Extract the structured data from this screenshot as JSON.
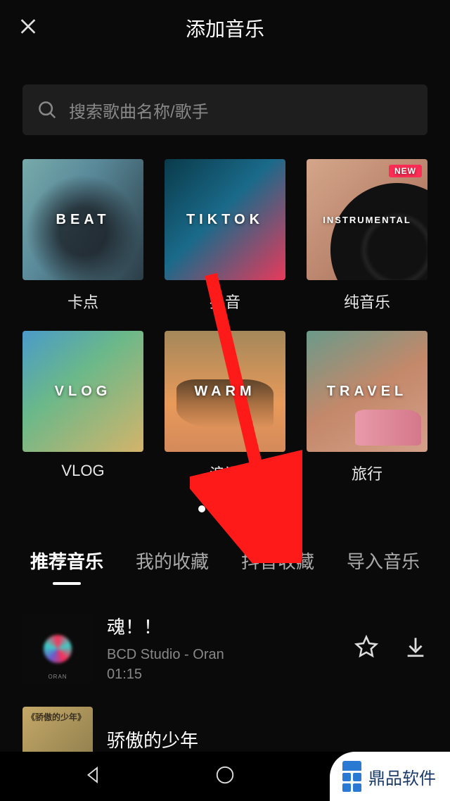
{
  "header": {
    "title": "添加音乐"
  },
  "search": {
    "placeholder": "搜索歌曲名称/歌手"
  },
  "categories": [
    {
      "overlay": "BEAT",
      "label": "卡点",
      "style": "cat-beat",
      "badge": null
    },
    {
      "overlay": "TIKTOK",
      "label": "抖音",
      "style": "cat-tiktok",
      "badge": null
    },
    {
      "overlay": "INSTRUMENTAL",
      "label": "纯音乐",
      "style": "cat-instrumental",
      "badge": "NEW"
    },
    {
      "overlay": "VLOG",
      "label": "VLOG",
      "style": "cat-vlog",
      "badge": null
    },
    {
      "overlay": "WARM",
      "label": "浪漫",
      "style": "cat-warm",
      "badge": null
    },
    {
      "overlay": "TRAVEL",
      "label": "旅行",
      "style": "cat-travel",
      "badge": null
    }
  ],
  "pager": {
    "total": 4,
    "active": 0
  },
  "tabs": [
    {
      "label": "推荐音乐",
      "active": true
    },
    {
      "label": "我的收藏",
      "active": false
    },
    {
      "label": "抖音收藏",
      "active": false
    },
    {
      "label": "导入音乐",
      "active": false
    }
  ],
  "tracks": [
    {
      "title": "魂！！",
      "artist": "BCD Studio - Oran",
      "duration": "01:15",
      "thumb": "thumb-oran"
    },
    {
      "title": "骄傲的少年",
      "artist": "",
      "duration": "",
      "thumb": "thumb-proud",
      "thumb_text": "《骄傲的少年》"
    }
  ],
  "watermark": {
    "text": "鼎品软件"
  }
}
